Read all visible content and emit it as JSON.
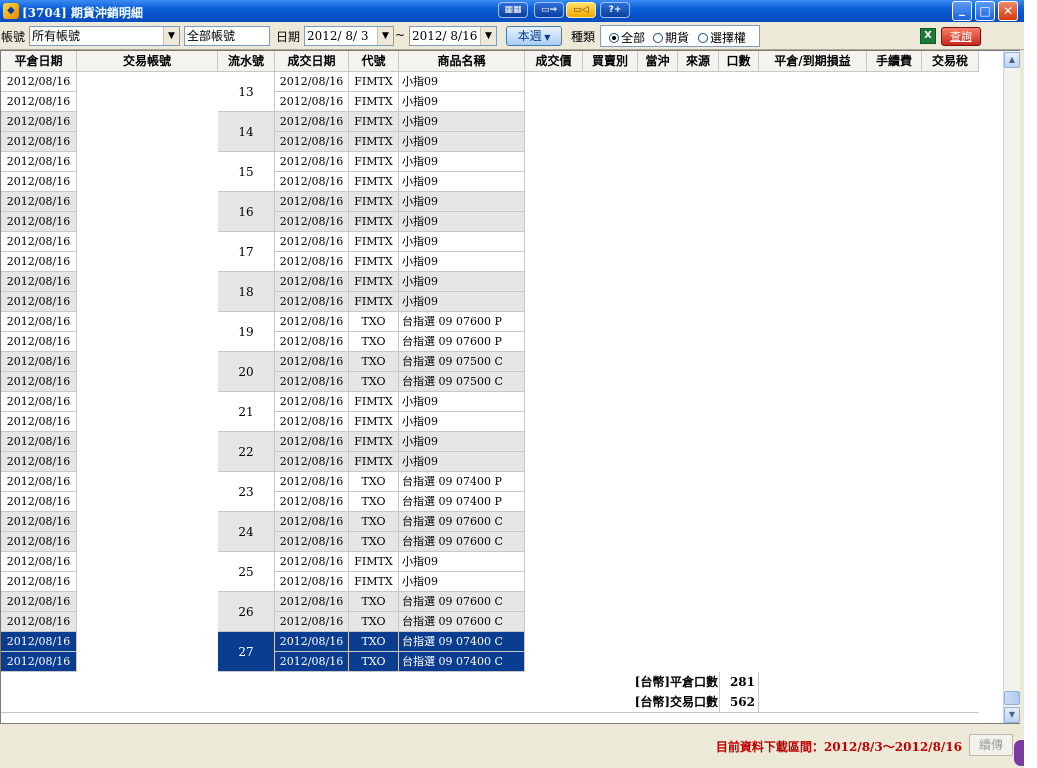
{
  "window": {
    "title": "[3704] 期貨沖銷明細",
    "app_icon_glyph": "◆"
  },
  "title_tools": [
    "▦▦",
    "▭→",
    "▭◁",
    "?+"
  ],
  "window_buttons": {
    "minimize": "_",
    "maximize": "□",
    "close": "✕"
  },
  "filter": {
    "account_label": "帳號",
    "account_value": "所有帳號",
    "account_name": "全部帳號",
    "date_label": "日期",
    "date_from": "2012/ 8/ 3",
    "date_sep": "~",
    "date_to": "2012/ 8/16",
    "period_button": "本週",
    "type_label": "種類",
    "type_options": [
      "全部",
      "期貨",
      "選擇權"
    ],
    "type_selected": "全部",
    "excel_icon": "X",
    "query_button": "查詢"
  },
  "columns": [
    "平倉日期",
    "交易帳號",
    "流水號",
    "成交日期",
    "代號",
    "商品名稱",
    "成交價",
    "買賣別",
    "當沖",
    "來源",
    "口數",
    "平倉/到期損益",
    "手續費",
    "交易稅"
  ],
  "groups": [
    {
      "serial": "13",
      "rows": [
        {
          "close_date": "2012/08/16",
          "trade_date": "2012/08/16",
          "code": "FIMTX",
          "name": "小指09"
        },
        {
          "close_date": "2012/08/16",
          "trade_date": "2012/08/16",
          "code": "FIMTX",
          "name": "小指09"
        }
      ]
    },
    {
      "serial": "14",
      "rows": [
        {
          "close_date": "2012/08/16",
          "trade_date": "2012/08/16",
          "code": "FIMTX",
          "name": "小指09"
        },
        {
          "close_date": "2012/08/16",
          "trade_date": "2012/08/16",
          "code": "FIMTX",
          "name": "小指09"
        }
      ]
    },
    {
      "serial": "15",
      "rows": [
        {
          "close_date": "2012/08/16",
          "trade_date": "2012/08/16",
          "code": "FIMTX",
          "name": "小指09"
        },
        {
          "close_date": "2012/08/16",
          "trade_date": "2012/08/16",
          "code": "FIMTX",
          "name": "小指09"
        }
      ]
    },
    {
      "serial": "16",
      "rows": [
        {
          "close_date": "2012/08/16",
          "trade_date": "2012/08/16",
          "code": "FIMTX",
          "name": "小指09"
        },
        {
          "close_date": "2012/08/16",
          "trade_date": "2012/08/16",
          "code": "FIMTX",
          "name": "小指09"
        }
      ]
    },
    {
      "serial": "17",
      "rows": [
        {
          "close_date": "2012/08/16",
          "trade_date": "2012/08/16",
          "code": "FIMTX",
          "name": "小指09"
        },
        {
          "close_date": "2012/08/16",
          "trade_date": "2012/08/16",
          "code": "FIMTX",
          "name": "小指09"
        }
      ]
    },
    {
      "serial": "18",
      "rows": [
        {
          "close_date": "2012/08/16",
          "trade_date": "2012/08/16",
          "code": "FIMTX",
          "name": "小指09"
        },
        {
          "close_date": "2012/08/16",
          "trade_date": "2012/08/16",
          "code": "FIMTX",
          "name": "小指09"
        }
      ]
    },
    {
      "serial": "19",
      "rows": [
        {
          "close_date": "2012/08/16",
          "trade_date": "2012/08/16",
          "code": "TXO",
          "name": "台指選 09 07600 P"
        },
        {
          "close_date": "2012/08/16",
          "trade_date": "2012/08/16",
          "code": "TXO",
          "name": "台指選 09 07600 P"
        }
      ]
    },
    {
      "serial": "20",
      "rows": [
        {
          "close_date": "2012/08/16",
          "trade_date": "2012/08/16",
          "code": "TXO",
          "name": "台指選 09 07500 C"
        },
        {
          "close_date": "2012/08/16",
          "trade_date": "2012/08/16",
          "code": "TXO",
          "name": "台指選 09 07500 C"
        }
      ]
    },
    {
      "serial": "21",
      "rows": [
        {
          "close_date": "2012/08/16",
          "trade_date": "2012/08/16",
          "code": "FIMTX",
          "name": "小指09"
        },
        {
          "close_date": "2012/08/16",
          "trade_date": "2012/08/16",
          "code": "FIMTX",
          "name": "小指09"
        }
      ]
    },
    {
      "serial": "22",
      "rows": [
        {
          "close_date": "2012/08/16",
          "trade_date": "2012/08/16",
          "code": "FIMTX",
          "name": "小指09"
        },
        {
          "close_date": "2012/08/16",
          "trade_date": "2012/08/16",
          "code": "FIMTX",
          "name": "小指09"
        }
      ]
    },
    {
      "serial": "23",
      "rows": [
        {
          "close_date": "2012/08/16",
          "trade_date": "2012/08/16",
          "code": "TXO",
          "name": "台指選 09 07400 P"
        },
        {
          "close_date": "2012/08/16",
          "trade_date": "2012/08/16",
          "code": "TXO",
          "name": "台指選 09 07400 P"
        }
      ]
    },
    {
      "serial": "24",
      "rows": [
        {
          "close_date": "2012/08/16",
          "trade_date": "2012/08/16",
          "code": "TXO",
          "name": "台指選 09 07600 C"
        },
        {
          "close_date": "2012/08/16",
          "trade_date": "2012/08/16",
          "code": "TXO",
          "name": "台指選 09 07600 C"
        }
      ]
    },
    {
      "serial": "25",
      "rows": [
        {
          "close_date": "2012/08/16",
          "trade_date": "2012/08/16",
          "code": "FIMTX",
          "name": "小指09"
        },
        {
          "close_date": "2012/08/16",
          "trade_date": "2012/08/16",
          "code": "FIMTX",
          "name": "小指09"
        }
      ]
    },
    {
      "serial": "26",
      "rows": [
        {
          "close_date": "2012/08/16",
          "trade_date": "2012/08/16",
          "code": "TXO",
          "name": "台指選 09 07600 C"
        },
        {
          "close_date": "2012/08/16",
          "trade_date": "2012/08/16",
          "code": "TXO",
          "name": "台指選 09 07600 C"
        }
      ]
    },
    {
      "serial": "27",
      "selected": true,
      "rows": [
        {
          "close_date": "2012/08/16",
          "trade_date": "2012/08/16",
          "code": "TXO",
          "name": "台指選 09 07400 C"
        },
        {
          "close_date": "2012/08/16",
          "trade_date": "2012/08/16",
          "code": "TXO",
          "name": "台指選 09 07400 C"
        }
      ]
    }
  ],
  "summary": [
    {
      "label": "[台幣]平倉口數",
      "value": "281"
    },
    {
      "label": "[台幣]交易口數",
      "value": "562"
    }
  ],
  "scrollbar": {
    "up": "▲",
    "down": "▼"
  },
  "status": {
    "message": "目前資料下載區間：2012/8/3～2012/8/16",
    "resume_button": "續傳"
  },
  "colors": {
    "selected_row": "#0a3d8f",
    "shaded_row": "#e6e6e6",
    "status_text": "#c00000",
    "titlebar": "#0a5fd8"
  }
}
